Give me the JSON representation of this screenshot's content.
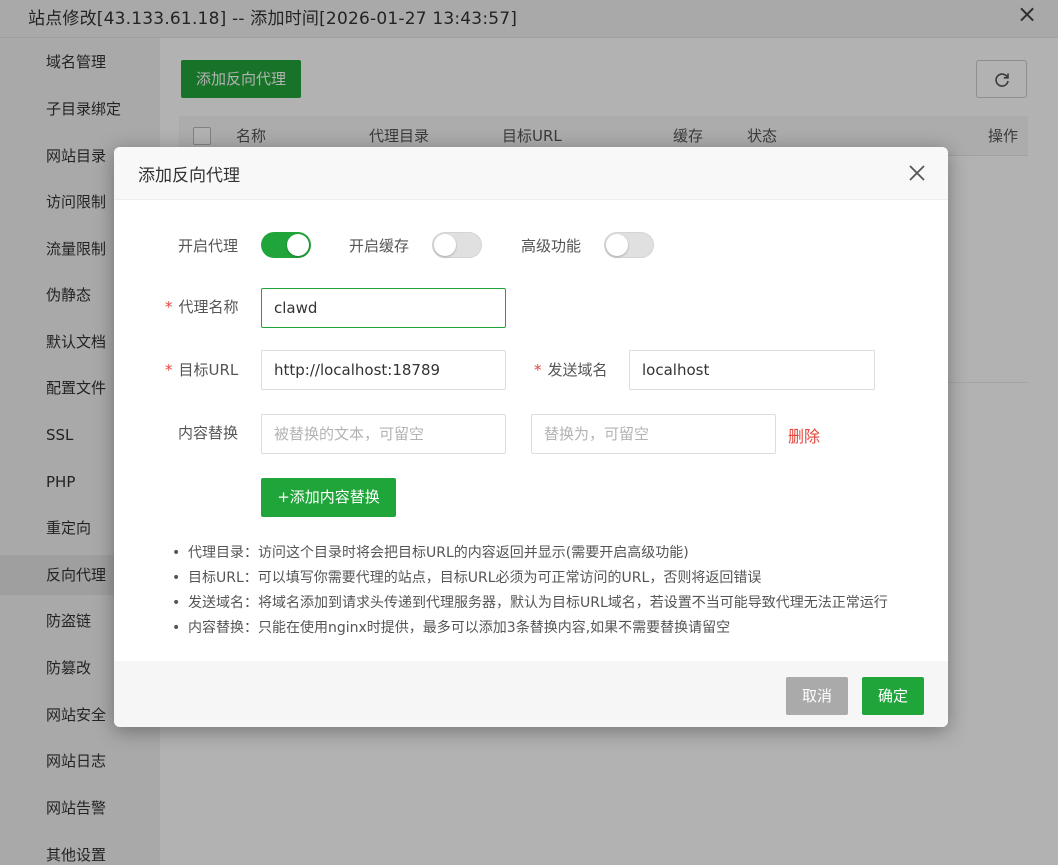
{
  "window": {
    "title": "站点修改[43.133.61.18] -- 添加时间[2026-01-27 13:43:57]",
    "close_symbol": "×"
  },
  "sidebar": {
    "items": [
      {
        "label": "域名管理"
      },
      {
        "label": "子目录绑定"
      },
      {
        "label": "网站目录"
      },
      {
        "label": "访问限制"
      },
      {
        "label": "流量限制"
      },
      {
        "label": "伪静态"
      },
      {
        "label": "默认文档"
      },
      {
        "label": "配置文件"
      },
      {
        "label": "SSL"
      },
      {
        "label": "PHP"
      },
      {
        "label": "重定向"
      },
      {
        "label": "反向代理"
      },
      {
        "label": "防盗链"
      },
      {
        "label": "防篡改"
      },
      {
        "label": "网站安全"
      },
      {
        "label": "网站日志"
      },
      {
        "label": "网站告警"
      },
      {
        "label": "其他设置"
      }
    ],
    "active": "反向代理"
  },
  "main": {
    "add_button": "添加反向代理",
    "refresh_icon": "refresh-icon",
    "columns": {
      "name": "名称",
      "dir": "代理目录",
      "url": "目标URL",
      "cache": "缓存",
      "status": "状态",
      "ops": "操作"
    }
  },
  "modal": {
    "title": "添加反向代理",
    "toggles": {
      "proxy_label": "开启代理",
      "proxy_on": true,
      "cache_label": "开启缓存",
      "cache_on": false,
      "advanced_label": "高级功能",
      "advanced_on": false
    },
    "required_mark": "*",
    "proxy_name": {
      "label": "代理名称",
      "value": "clawd"
    },
    "target_url": {
      "label": "目标URL",
      "value": "http://localhost:18789"
    },
    "send_domain": {
      "label": "发送域名",
      "value": "localhost"
    },
    "replace": {
      "label": "内容替换",
      "from_placeholder": "被替换的文本，可留空",
      "to_placeholder": "替换为，可留空",
      "delete_label": "删除"
    },
    "add_replace_button": "+添加内容替换",
    "notes": [
      "代理目录：访问这个目录时将会把目标URL的内容返回并显示(需要开启高级功能)",
      "目标URL：可以填写你需要代理的站点，目标URL必须为可正常访问的URL，否则将返回错误",
      "发送域名：将域名添加到请求头传递到代理服务器，默认为目标URL域名，若设置不当可能导致代理无法正常运行",
      "内容替换：只能在使用nginx时提供，最多可以添加3条替换内容,如果不需要替换请留空"
    ],
    "cancel_button": "取消",
    "confirm_button": "确定"
  },
  "colors": {
    "accent": "#20a53a",
    "danger": "#e2453c",
    "cancel": "#aaaaaa"
  }
}
